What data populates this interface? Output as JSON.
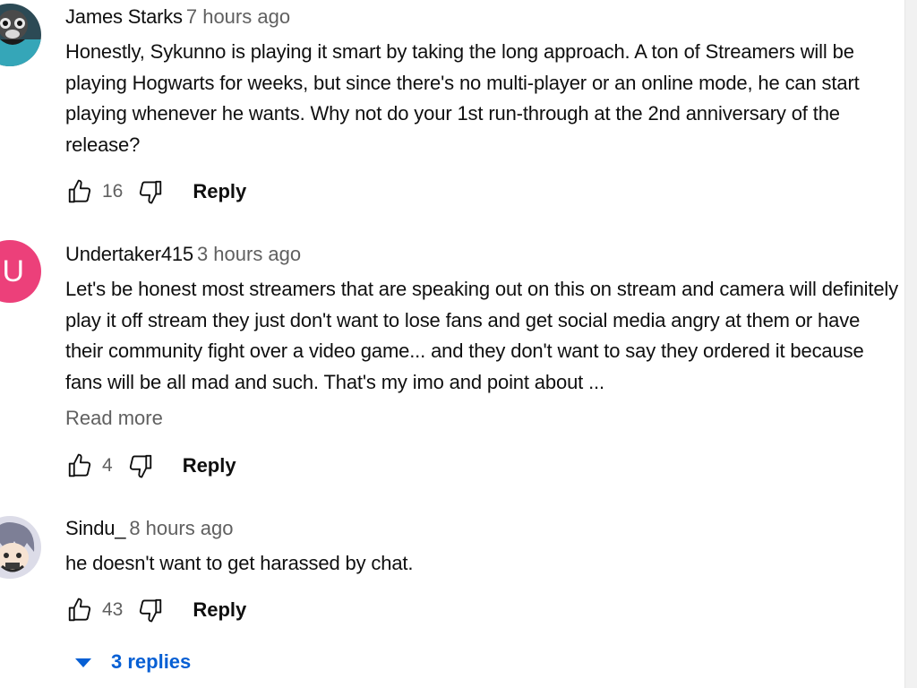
{
  "comments": [
    {
      "author": "James Starks",
      "time": "7 hours ago",
      "text": "Honestly, Sykunno is playing it smart by taking the long approach. A ton of Streamers will be playing Hogwarts for weeks, but since there's no multi-player or an online mode, he can start playing whenever he wants. Why not do your 1st run-through at the 2nd anniversary of the release?",
      "likes": "16",
      "reply_label": "Reply",
      "avatar_icon": "dog-photo-avatar"
    },
    {
      "author": "Undertaker415",
      "time": "3 hours ago",
      "avatar_letter": "U",
      "avatar_color": "#ec407a",
      "text": "Let's be honest most streamers that are speaking out on this on stream and camera will definitely play it off stream they just don't want to lose fans and get social media angry at them or have their community fight over a video game... and they don't want to say they ordered it because fans will be all mad and such. That's my imo and point about ...",
      "read_more": "Read more",
      "likes": "4",
      "reply_label": "Reply"
    },
    {
      "author": "Sindu_",
      "time": "8 hours ago",
      "text": "he doesn't want to get harassed by chat.",
      "likes": "43",
      "reply_label": "Reply",
      "avatar_icon": "anime-character-avatar",
      "replies_label": "3 replies"
    }
  ],
  "colors": {
    "accent": "#065fd4",
    "secondary_text": "#606060"
  },
  "icons": {
    "like": "thumbs-up-icon",
    "dislike": "thumbs-down-icon",
    "expand": "caret-down-icon"
  }
}
